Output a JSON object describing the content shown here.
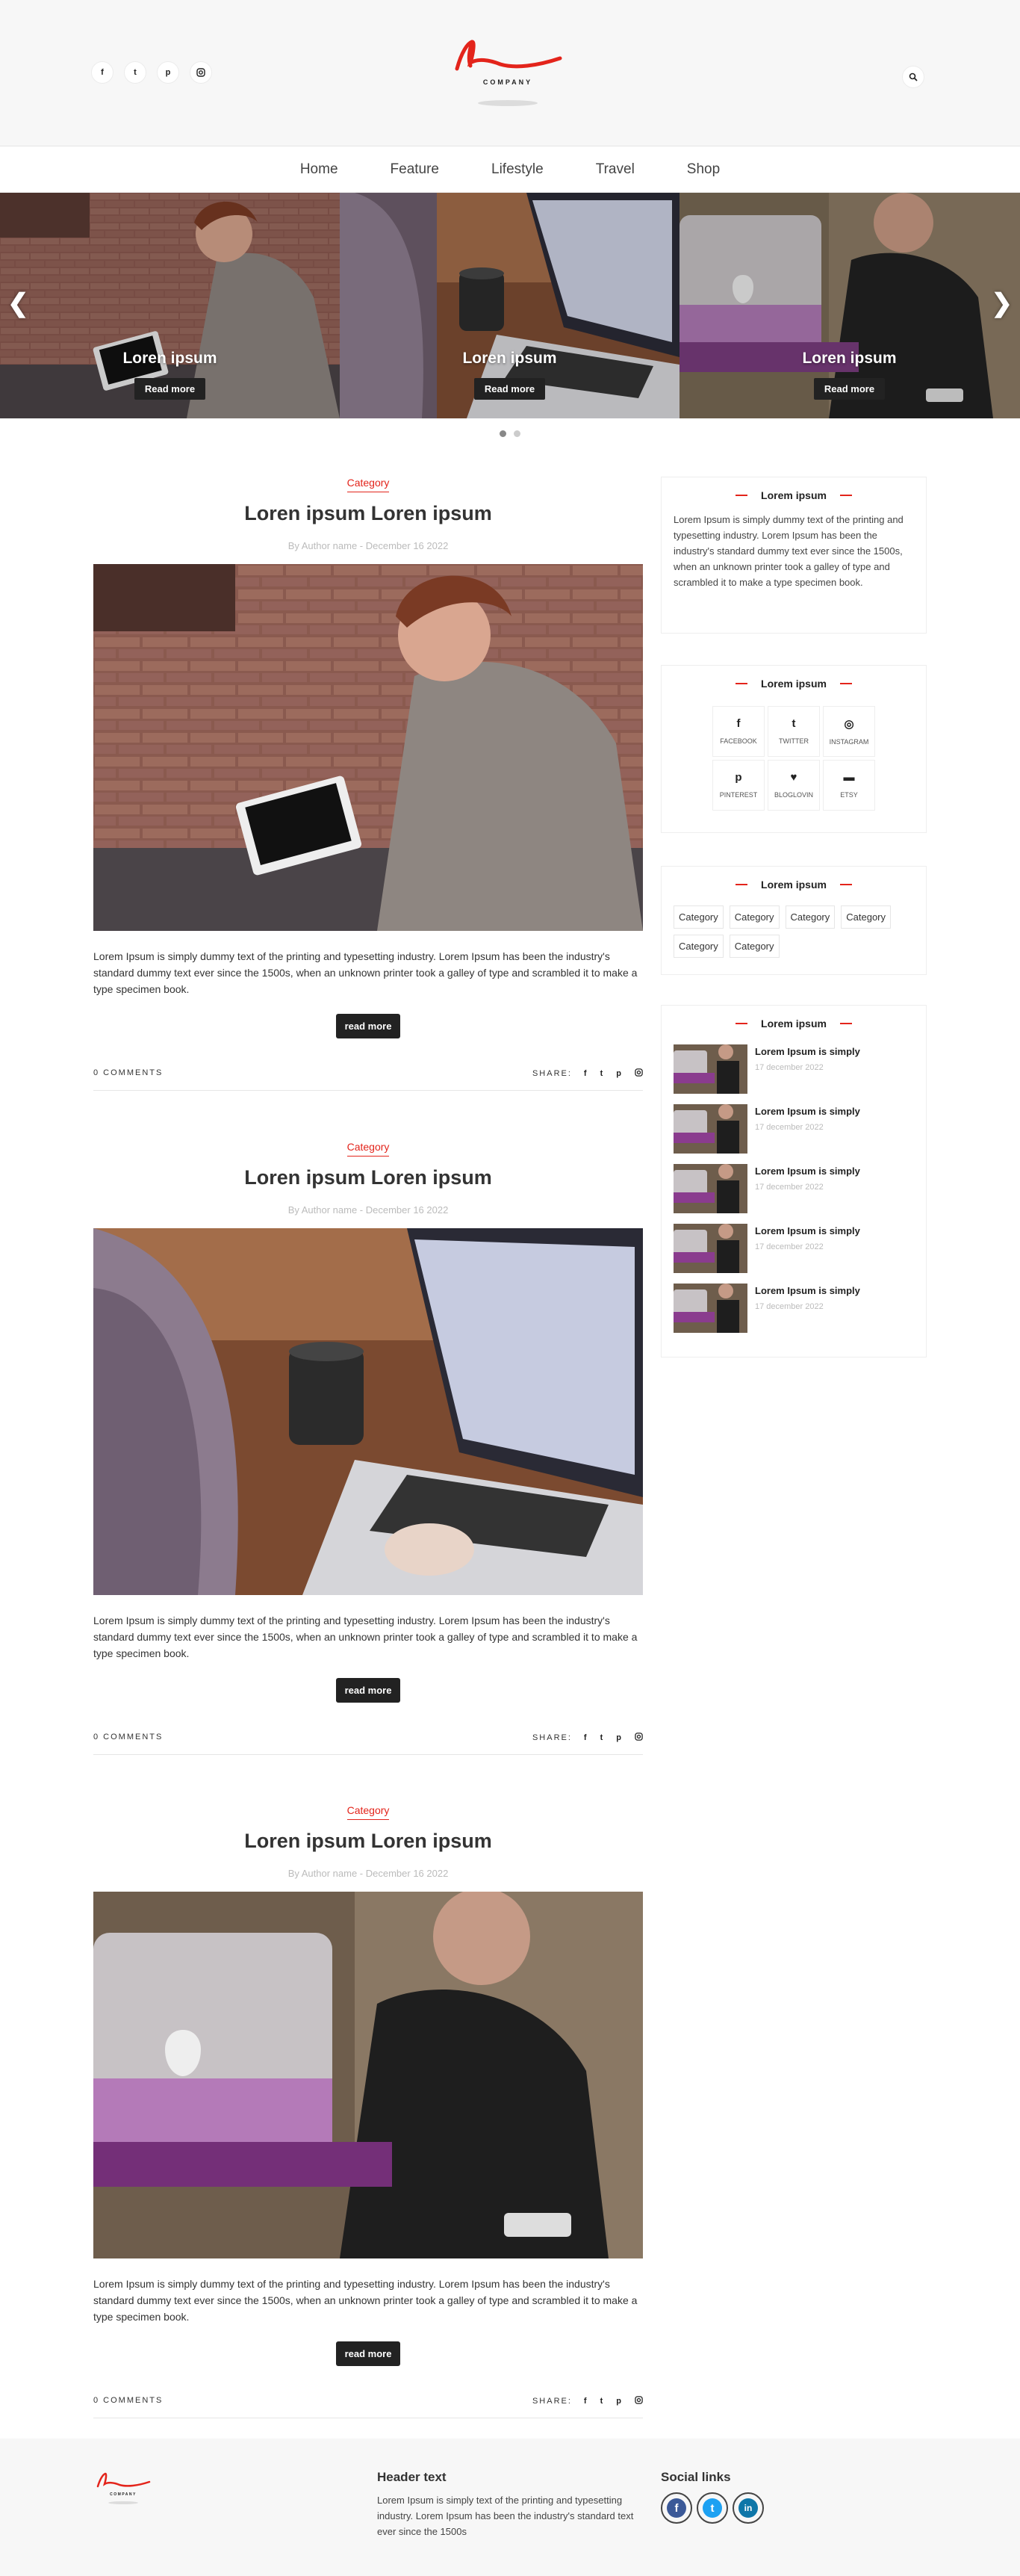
{
  "brand": {
    "logo_text": "COMPANY",
    "red": "#e3241b"
  },
  "header": {
    "socials": [
      {
        "icon": "facebook-icon",
        "glyph": "f"
      },
      {
        "icon": "twitter-icon",
        "glyph": "t"
      },
      {
        "icon": "pinterest-icon",
        "glyph": "p"
      },
      {
        "icon": "instagram-icon",
        "glyph": "ig"
      }
    ],
    "search_icon": "search-icon"
  },
  "nav": {
    "items": [
      "Home",
      "Feature",
      "Lifestyle",
      "Travel",
      "Shop"
    ]
  },
  "slider": {
    "slides": [
      {
        "title": "Loren ipsum",
        "button": "Read more"
      },
      {
        "title": "Loren ipsum",
        "button": "Read more"
      },
      {
        "title": "Loren ipsum",
        "button": "Read more"
      }
    ],
    "prev": "❮",
    "next": "❯"
  },
  "posts": [
    {
      "category": "Category",
      "title": "Loren ipsum Loren ipsum",
      "meta": "By Author name - December 16 2022",
      "excerpt": "Lorem Ipsum is simply dummy text of the printing and typesetting industry. Lorem Ipsum has been the industry's standard dummy text ever since the 1500s, when an unknown printer took a galley of type and scrambled it to make a type specimen book.",
      "button": "read more",
      "comments": "0 COMMENTS",
      "share": "SHARE:"
    },
    {
      "category": "Category",
      "title": "Loren ipsum Loren ipsum",
      "meta": "By Author name - December 16 2022",
      "excerpt": "Lorem Ipsum is simply dummy text of the printing and typesetting industry. Lorem Ipsum has been the industry's standard dummy text ever since the 1500s, when an unknown printer took a galley of type and scrambled it to make a type specimen book.",
      "button": "read more",
      "comments": "0 COMMENTS",
      "share": "SHARE:"
    },
    {
      "category": "Category",
      "title": "Loren ipsum Loren ipsum",
      "meta": "By Author name - December 16 2022",
      "excerpt": "Lorem Ipsum is simply dummy text of the printing and typesetting industry. Lorem Ipsum has been the industry's standard dummy text ever since the 1500s, when an unknown printer took a galley of type and scrambled it to make a type specimen book.",
      "button": "read more",
      "comments": "0 COMMENTS",
      "share": "SHARE:"
    }
  ],
  "sidebar": {
    "about": {
      "title": "Lorem ipsum",
      "text": "Lorem Ipsum is simply dummy text of the printing and typesetting industry. Lorem Ipsum has been the industry's standard dummy text ever since the 1500s, when an unknown printer took a galley of type and scrambled it to make a type specimen book."
    },
    "follow": {
      "title": "Lorem ipsum",
      "items": [
        {
          "label": "FACEBOOK",
          "glyph": "f",
          "icon": "facebook-icon"
        },
        {
          "label": "TWITTER",
          "glyph": "t",
          "icon": "twitter-icon"
        },
        {
          "label": "INSTAGRAM",
          "glyph": "◎",
          "icon": "instagram-icon"
        },
        {
          "label": "PINTEREST",
          "glyph": "p",
          "icon": "pinterest-icon"
        },
        {
          "label": "BLOGLOVIN",
          "glyph": "♥",
          "icon": "heart-icon"
        },
        {
          "label": "ETSY",
          "glyph": "▬",
          "icon": "cart-icon"
        }
      ]
    },
    "categories": {
      "title": "Lorem ipsum",
      "tags": [
        "Category",
        "Category",
        "Category",
        "Category",
        "Category",
        "Category"
      ]
    },
    "recent": {
      "title": "Lorem ipsum",
      "items": [
        {
          "title": "Lorem Ipsum is simply",
          "date": "17 december 2022"
        },
        {
          "title": "Lorem Ipsum is simply",
          "date": "17 december 2022"
        },
        {
          "title": "Lorem Ipsum is simply",
          "date": "17 december 2022"
        },
        {
          "title": "Lorem Ipsum is simply",
          "date": "17 december 2022"
        },
        {
          "title": "Lorem Ipsum is simply",
          "date": "17 december 2022"
        }
      ]
    }
  },
  "footer": {
    "logo_text": "COMPANY",
    "header_text": "Header text",
    "text": "Lorem Ipsum is simply text of the printing and typesetting industry. Lorem Ipsum has been the industry's standard text ever since the 1500s",
    "social_title": "Social links",
    "links": [
      {
        "icon": "facebook-icon",
        "glyph": "f",
        "color": "#3b5998"
      },
      {
        "icon": "twitter-icon",
        "glyph": "t",
        "color": "#1da1f2"
      },
      {
        "icon": "linkedin-icon",
        "glyph": "in",
        "color": "#0e76a8"
      }
    ]
  }
}
